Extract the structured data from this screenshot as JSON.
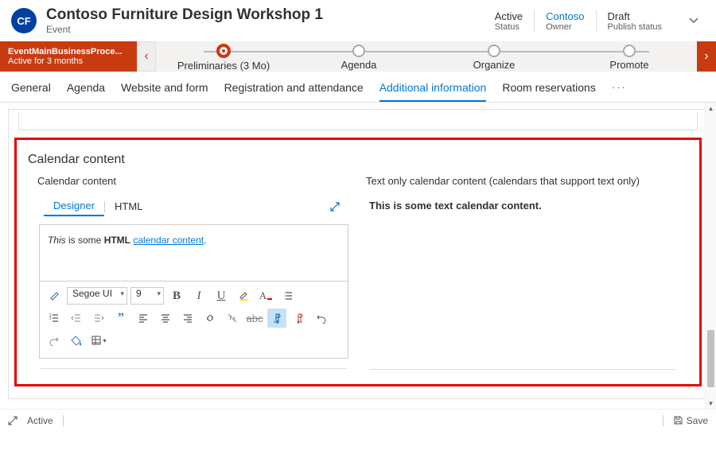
{
  "header": {
    "avatar_initials": "CF",
    "title": "Contoso Furniture Design Workshop 1",
    "subtitle": "Event",
    "meta": [
      {
        "value": "Active",
        "label": "Status",
        "link": false
      },
      {
        "value": "Contoso",
        "label": "Owner",
        "link": true
      },
      {
        "value": "Draft",
        "label": "Publish status",
        "link": false
      }
    ]
  },
  "bpf": {
    "current_name": "EventMainBusinessProce...",
    "current_duration": "Active for 3 months",
    "stages": [
      {
        "label": "Preliminaries  (3 Mo)",
        "active": true
      },
      {
        "label": "Agenda",
        "active": false
      },
      {
        "label": "Organize",
        "active": false
      },
      {
        "label": "Promote",
        "active": false
      }
    ]
  },
  "tabs": [
    "General",
    "Agenda",
    "Website and form",
    "Registration and attendance",
    "Additional information",
    "Room reservations"
  ],
  "active_tab_index": 4,
  "section": {
    "title": "Calendar content",
    "left": {
      "label": "Calendar content",
      "editor_tabs": [
        "Designer",
        "HTML"
      ],
      "font_name": "Segoe UI",
      "font_size": "9",
      "html_value_parts": {
        "p1_italic": "This",
        "p2_plain": " is some ",
        "p3_bold": "HTML",
        "p4_plain": " ",
        "p5_link": "calendar content",
        "p6_plain": "."
      }
    },
    "right": {
      "label": "Text only calendar content (calendars that support text only)",
      "value": "This is some text calendar content."
    }
  },
  "footer": {
    "status": "Active",
    "save": "Save"
  }
}
